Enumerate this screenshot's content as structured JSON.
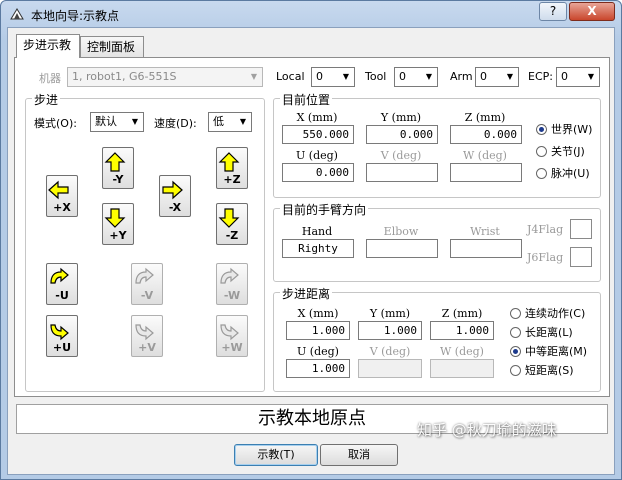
{
  "window": {
    "title": "本地向导:示教点",
    "help_label": "?",
    "close_label": "X"
  },
  "tabs": [
    {
      "label": "步进示教"
    },
    {
      "label": "控制面板"
    }
  ],
  "toolbar": {
    "robot_label": "机器",
    "robot_value": "1, robot1, G6-551S",
    "local_label": "Local",
    "local_value": "0",
    "tool_label": "Tool",
    "tool_value": "0",
    "arm_label": "Arm",
    "arm_value": "0",
    "ecp_label": "ECP:",
    "ecp_value": "0"
  },
  "step_group": {
    "title": "步进",
    "mode_label": "模式(O):",
    "mode_value": "默认",
    "speed_label": "速度(D):",
    "speed_value": "低",
    "jog_buttons": [
      {
        "id": "minus-y",
        "label": "-Y",
        "icon": "arrow-up",
        "enabled": true
      },
      {
        "id": "plus-z",
        "label": "+Z",
        "icon": "arrow-up",
        "enabled": true
      },
      {
        "id": "plus-x",
        "label": "+X",
        "icon": "arrow-left",
        "enabled": true
      },
      {
        "id": "minus-x",
        "label": "-X",
        "icon": "arrow-right",
        "enabled": true
      },
      {
        "id": "plus-y",
        "label": "+Y",
        "icon": "arrow-down",
        "enabled": true
      },
      {
        "id": "minus-z",
        "label": "-Z",
        "icon": "arrow-down",
        "enabled": true
      },
      {
        "id": "minus-u",
        "label": "-U",
        "icon": "rotate-ccw",
        "enabled": true
      },
      {
        "id": "minus-v",
        "label": "-V",
        "icon": "rotate-ccw",
        "enabled": false
      },
      {
        "id": "minus-w",
        "label": "-W",
        "icon": "rotate-ccw",
        "enabled": false
      },
      {
        "id": "plus-u",
        "label": "+U",
        "icon": "rotate-cw",
        "enabled": true
      },
      {
        "id": "plus-v",
        "label": "+V",
        "icon": "rotate-cw",
        "enabled": false
      },
      {
        "id": "plus-w",
        "label": "+W",
        "icon": "rotate-cw",
        "enabled": false
      }
    ]
  },
  "position_group": {
    "title": "目前位置",
    "x_label": "X (mm)",
    "x_value": "550.000",
    "y_label": "Y (mm)",
    "y_value": "0.000",
    "z_label": "Z (mm)",
    "z_value": "0.000",
    "u_label": "U (deg)",
    "u_value": "0.000",
    "v_label": "V (deg)",
    "v_value": "",
    "w_label": "W (deg)",
    "w_value": "",
    "radios": [
      {
        "label": "世界(W)",
        "selected": true
      },
      {
        "label": "关节(J)",
        "selected": false
      },
      {
        "label": "脉冲(U)",
        "selected": false
      }
    ]
  },
  "arm_orientation_group": {
    "title": "目前的手臂方向",
    "hand_label": "Hand",
    "hand_value": "Righty",
    "elbow_label": "Elbow",
    "elbow_value": "",
    "wrist_label": "Wrist",
    "wrist_value": "",
    "j4flag_label": "J4Flag",
    "j6flag_label": "J6Flag"
  },
  "step_distance_group": {
    "title": "步进距离",
    "x_label": "X (mm)",
    "x_value": "1.000",
    "y_label": "Y (mm)",
    "y_value": "1.000",
    "z_label": "Z (mm)",
    "z_value": "1.000",
    "u_label": "U (deg)",
    "u_value": "1.000",
    "v_label": "V (deg)",
    "v_value": "",
    "w_label": "W (deg)",
    "w_value": "",
    "radios": [
      {
        "label": "连续动作(C)",
        "selected": false
      },
      {
        "label": "长距离(L)",
        "selected": false
      },
      {
        "label": "中等距离(M)",
        "selected": true
      },
      {
        "label": "短距离(S)",
        "selected": false
      }
    ]
  },
  "status_text": "示教本地原点",
  "buttons": {
    "teach_label": "示教(T)",
    "cancel_label": "取消"
  },
  "watermark": "知乎 @秋刀瑜的滋味",
  "colors": {
    "arrow_yellow": "#ffff00",
    "disabled_gray": "#9a9a9a",
    "title_gradient": "#b4cbe6"
  }
}
